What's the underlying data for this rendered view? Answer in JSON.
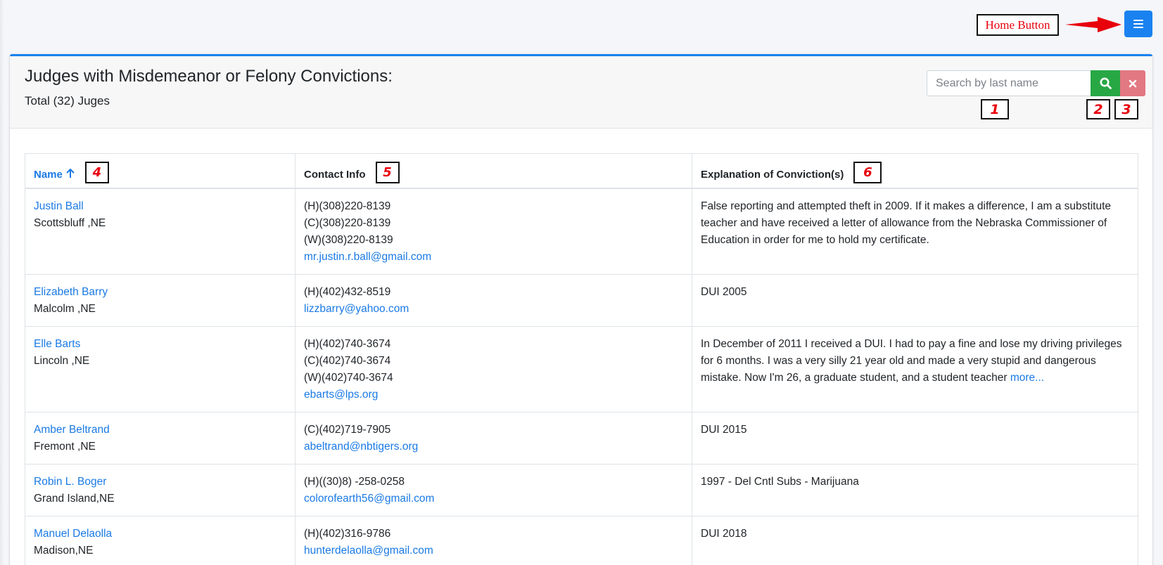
{
  "annotations": {
    "home_label": "Home Button",
    "search_input_num": "1",
    "search_button_num": "2",
    "clear_button_num": "3",
    "name_col_num": "4",
    "contact_col_num": "5",
    "explanation_col_num": "6"
  },
  "header": {
    "title": "Judges with Misdemeanor or Felony Convictions:",
    "subtitle": "Total (32) Juges"
  },
  "search": {
    "placeholder": "Search by last name",
    "value": ""
  },
  "colors": {
    "primary": "#1a82f0",
    "success": "#28a745",
    "danger": "#e27882",
    "annotation_red": "#e8000b"
  },
  "icons": {
    "menu": "hamburger-icon",
    "search": "magnifier-icon",
    "clear": "close-icon",
    "sort": "arrow-up-icon"
  },
  "table": {
    "columns": [
      "Name",
      "Contact Info",
      "Explanation of Conviction(s)"
    ],
    "rows": [
      {
        "name": "Justin Ball",
        "location": "Scottsbluff ,NE",
        "contact": [
          "(H)(308)220-8139",
          "(C)(308)220-8139",
          "(W)(308)220-8139"
        ],
        "email": "mr.justin.r.ball@gmail.com",
        "explanation": "False reporting and attempted theft in 2009. If it makes a difference, I am a substitute teacher and have received a letter of allowance from the Nebraska Commissioner of Education in order for me to hold my certificate.",
        "more": ""
      },
      {
        "name": "Elizabeth Barry",
        "location": "Malcolm ,NE",
        "contact": [
          "(H)(402)432-8519"
        ],
        "email": "lizzbarry@yahoo.com",
        "explanation": "DUI 2005",
        "more": ""
      },
      {
        "name": "Elle Barts",
        "location": "Lincoln ,NE",
        "contact": [
          "(H)(402)740-3674",
          "(C)(402)740-3674",
          "(W)(402)740-3674"
        ],
        "email": "ebarts@lps.org",
        "explanation": "In December of 2011 I received a DUI. I had to pay a fine and lose my driving privileges for 6 months. I was a very silly 21 year old and made a very stupid and dangerous mistake. Now I'm 26, a graduate student, and a student teacher ",
        "more": "more..."
      },
      {
        "name": "Amber Beltrand",
        "location": "Fremont ,NE",
        "contact": [
          "(C)(402)719-7905"
        ],
        "email": "abeltrand@nbtigers.org",
        "explanation": "DUI 2015",
        "more": ""
      },
      {
        "name": "Robin L. Boger",
        "location": "Grand Island,NE",
        "contact": [
          "(H)((30)8) -258-0258"
        ],
        "email": "colorofearth56@gmail.com",
        "explanation": "1997 - Del Cntl Subs - Marijuana",
        "more": ""
      },
      {
        "name": "Manuel Delaolla",
        "location": "Madison,NE",
        "contact": [
          "(H)(402)316-9786"
        ],
        "email": "hunterdelaolla@gmail.com",
        "explanation": "DUI 2018",
        "more": ""
      }
    ]
  }
}
